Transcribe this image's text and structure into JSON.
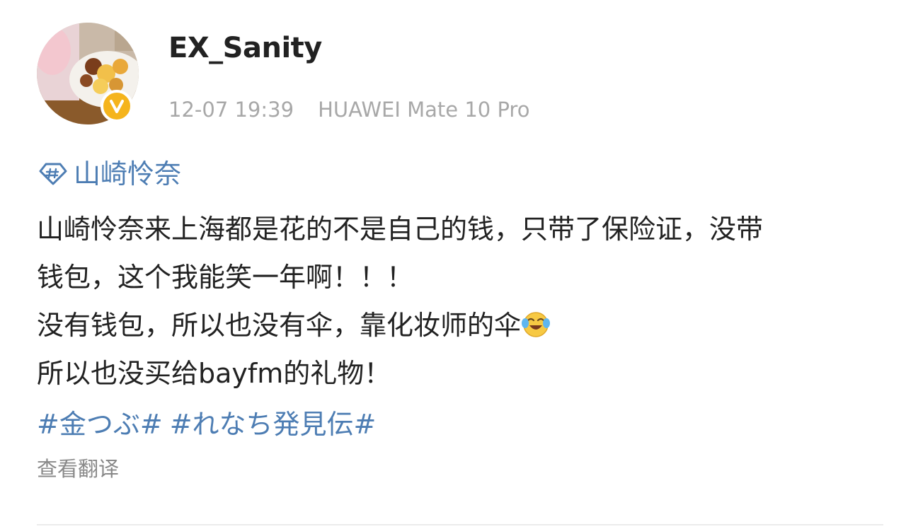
{
  "user": {
    "username": "EX_Sanity",
    "verified": true,
    "badge_color": "#f5b41c"
  },
  "meta": {
    "time": "12-07 19:39",
    "device": "HUAWEI Mate 10 Pro"
  },
  "topic": {
    "icon": "topic-diamond-icon",
    "label": "山崎怜奈"
  },
  "post": {
    "lines": [
      "山崎怜奈来上海都是花的不是自己的钱，只带了保险证，没带",
      "钱包，这个我能笑一年啊！！！",
      "没有钱包，所以也没有伞，靠化妆师的伞",
      "所以也没买给bayfm的礼物！"
    ],
    "emoji": "laugh-cry-emoji"
  },
  "hashtags": [
    "#金つぶ#",
    "#れなち発見伝#"
  ],
  "translate_label": "查看翻译",
  "colors": {
    "link": "#4d7db3",
    "text": "#222222",
    "meta": "#a8a8a8"
  }
}
